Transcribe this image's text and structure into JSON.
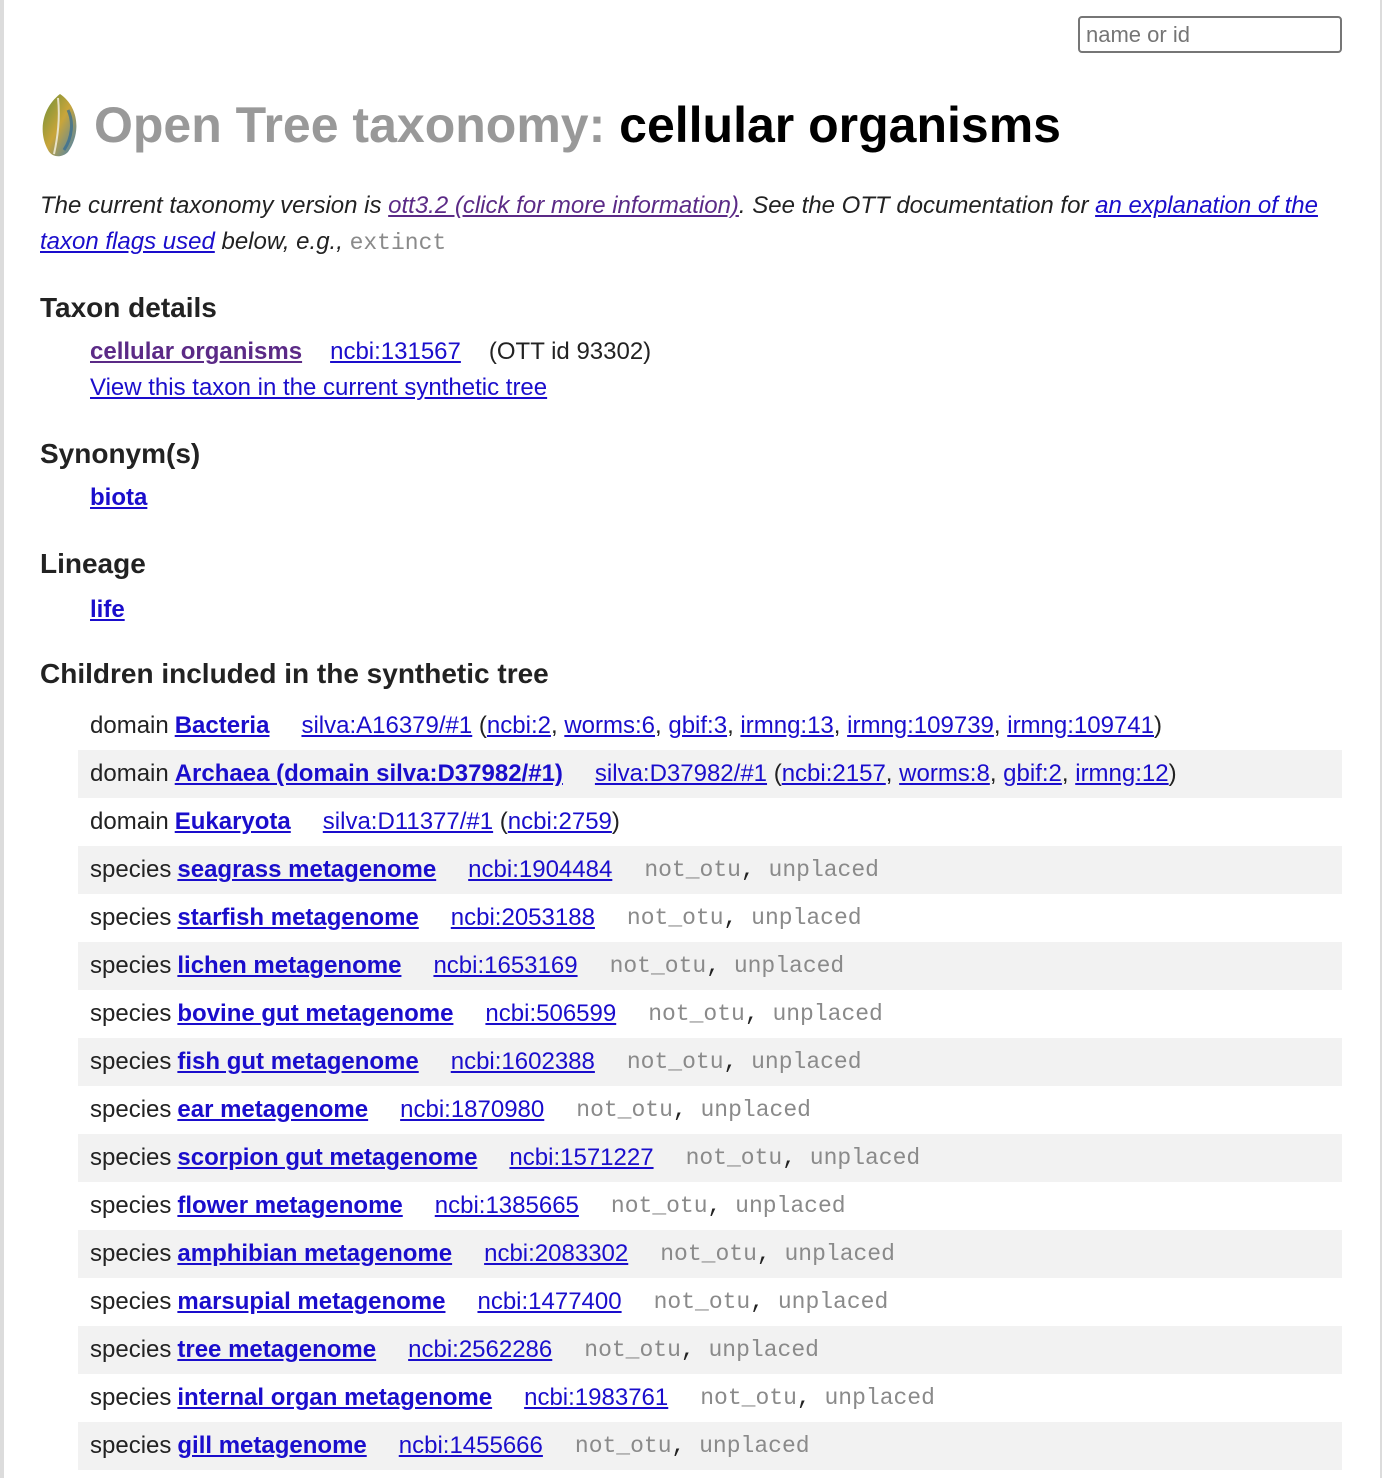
{
  "search": {
    "placeholder": "name or id"
  },
  "header": {
    "brand": "Open Tree taxonomy:",
    "taxon": "cellular organisms"
  },
  "intro": {
    "text_before": "The current taxonomy version is ",
    "version_link": "ott3.2 (click for more information)",
    "text_middle": ". See the OTT documentation for ",
    "flags_link": "an explanation of the taxon flags used",
    "text_after": " below, e.g., ",
    "example_flag": "extinct"
  },
  "details": {
    "heading": "Taxon details",
    "name": "cellular organisms",
    "source": "ncbi:131567",
    "ott_id": "(OTT id 93302)",
    "view_link": "View this taxon in the current synthetic tree"
  },
  "synonyms": {
    "heading": "Synonym(s)",
    "items": [
      "biota"
    ]
  },
  "lineage": {
    "heading": "Lineage",
    "items": [
      "life"
    ]
  },
  "children": {
    "heading": "Children included in the synthetic tree",
    "rows": [
      {
        "rank": "domain",
        "name": "Bacteria",
        "source": "silva:A16379/#1",
        "others": [
          "ncbi:2",
          "worms:6",
          "gbif:3",
          "irmng:13",
          "irmng:109739",
          "irmng:109741"
        ],
        "flags": []
      },
      {
        "rank": "domain",
        "name": "Archaea (domain silva:D37982/#1)",
        "source": "silva:D37982/#1",
        "others": [
          "ncbi:2157",
          "worms:8",
          "gbif:2",
          "irmng:12"
        ],
        "flags": []
      },
      {
        "rank": "domain",
        "name": "Eukaryota",
        "source": "silva:D11377/#1",
        "others": [
          "ncbi:2759"
        ],
        "flags": []
      },
      {
        "rank": "species",
        "name": "seagrass metagenome",
        "source": "ncbi:1904484",
        "others": [],
        "flags": [
          "not_otu",
          "unplaced"
        ]
      },
      {
        "rank": "species",
        "name": "starfish metagenome",
        "source": "ncbi:2053188",
        "others": [],
        "flags": [
          "not_otu",
          "unplaced"
        ]
      },
      {
        "rank": "species",
        "name": "lichen metagenome",
        "source": "ncbi:1653169",
        "others": [],
        "flags": [
          "not_otu",
          "unplaced"
        ]
      },
      {
        "rank": "species",
        "name": "bovine gut metagenome",
        "source": "ncbi:506599",
        "others": [],
        "flags": [
          "not_otu",
          "unplaced"
        ]
      },
      {
        "rank": "species",
        "name": "fish gut metagenome",
        "source": "ncbi:1602388",
        "others": [],
        "flags": [
          "not_otu",
          "unplaced"
        ]
      },
      {
        "rank": "species",
        "name": "ear metagenome",
        "source": "ncbi:1870980",
        "others": [],
        "flags": [
          "not_otu",
          "unplaced"
        ]
      },
      {
        "rank": "species",
        "name": "scorpion gut metagenome",
        "source": "ncbi:1571227",
        "others": [],
        "flags": [
          "not_otu",
          "unplaced"
        ]
      },
      {
        "rank": "species",
        "name": "flower metagenome",
        "source": "ncbi:1385665",
        "others": [],
        "flags": [
          "not_otu",
          "unplaced"
        ]
      },
      {
        "rank": "species",
        "name": "amphibian metagenome",
        "source": "ncbi:2083302",
        "others": [],
        "flags": [
          "not_otu",
          "unplaced"
        ]
      },
      {
        "rank": "species",
        "name": "marsupial metagenome",
        "source": "ncbi:1477400",
        "others": [],
        "flags": [
          "not_otu",
          "unplaced"
        ]
      },
      {
        "rank": "species",
        "name": "tree metagenome",
        "source": "ncbi:2562286",
        "others": [],
        "flags": [
          "not_otu",
          "unplaced"
        ]
      },
      {
        "rank": "species",
        "name": "internal organ metagenome",
        "source": "ncbi:1983761",
        "others": [],
        "flags": [
          "not_otu",
          "unplaced"
        ]
      },
      {
        "rank": "species",
        "name": "gill metagenome",
        "source": "ncbi:1455666",
        "others": [],
        "flags": [
          "not_otu",
          "unplaced"
        ]
      }
    ]
  }
}
